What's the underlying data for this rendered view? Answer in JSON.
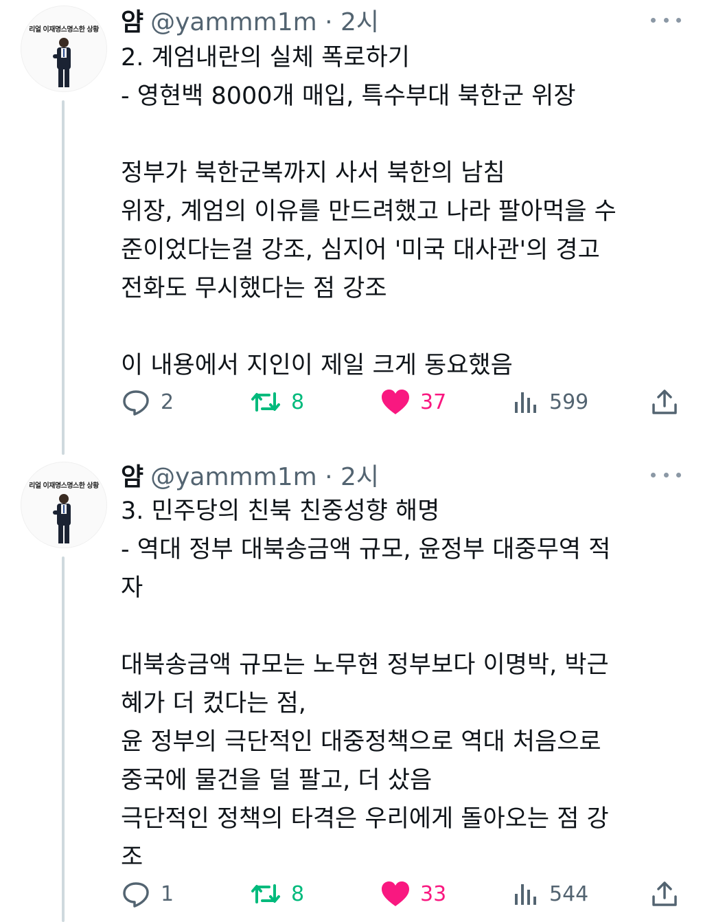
{
  "tweets": [
    {
      "avatar_caption": "리얼 이재명스명스한 상황",
      "author_name": "얌",
      "meta": "@yammm1m · 2시",
      "lines": [
        "2. 계엄내란의 실체 폭로하기",
        "- 영현백 8000개 매입, 특수부대 북한군 위장",
        "",
        "정부가 북한군복까지 사서 북한의 남침",
        "위장, 계엄의 이유를 만드려했고 나라 팔아먹을 수",
        "준이었다는걸 강조, 심지어 '미국 대사관'의 경고",
        "전화도 무시했다는 점 강조",
        "",
        "이 내용에서 지인이 제일 크게 동요했음"
      ],
      "replies": "2",
      "retweets": "8",
      "likes": "37",
      "views": "599"
    },
    {
      "avatar_caption": "리얼 이재명스명스한 상황",
      "author_name": "얌",
      "meta": "@yammm1m · 2시",
      "lines": [
        "3. 민주당의 친북 친중성향 해명",
        "- 역대 정부 대북송금액 규모, 윤정부 대중무역 적",
        "자",
        "",
        "대북송금액 규모는 노무현 정부보다 이명박, 박근",
        "혜가 더 컸다는 점,",
        "윤 정부의 극단적인 대중정책으로 역대 처음으로",
        "중국에 물건을 덜 팔고, 더 샀음",
        "극단적인 정책의 타격은 우리에게 돌아오는 점 강",
        "조"
      ],
      "replies": "1",
      "retweets": "8",
      "likes": "33",
      "views": "544"
    }
  ],
  "colors": {
    "text": "#0f1419",
    "secondary": "#536471",
    "retweet_green": "#00ba7c",
    "like_pink": "#f91880",
    "thread_line": "#cfd9de"
  },
  "icons": [
    "reply-icon",
    "retweet-icon",
    "like-icon",
    "views-icon",
    "share-icon",
    "more-icon"
  ],
  "liked": true
}
